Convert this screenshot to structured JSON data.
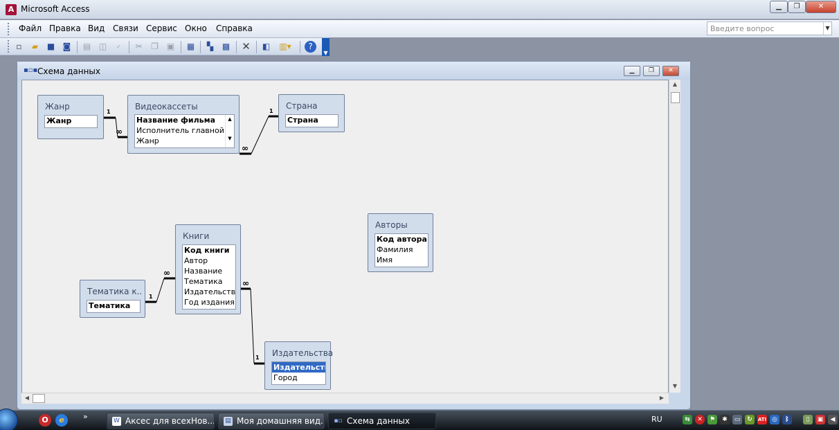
{
  "app": {
    "title": "Microsoft Access",
    "icon": "access-app-icon"
  },
  "window_buttons": {
    "minimize": "▁",
    "restore": "❐",
    "close": "✕"
  },
  "menu": [
    "Файл",
    "Правка",
    "Вид",
    "Связи",
    "Сервис",
    "Окно",
    "Справка"
  ],
  "help": {
    "placeholder": "Введите вопрос"
  },
  "toolbar": {
    "icons": [
      "new-icon",
      "open-icon",
      "save-icon",
      "file-search-icon",
      "print-icon",
      "print-preview-icon",
      "spelling-icon",
      "cut-icon",
      "copy-icon",
      "paste-icon",
      "show-table-icon",
      "show-direct-icon",
      "show-all-icon",
      "delete-icon",
      "new-object-icon",
      "office-links-icon",
      "help-icon"
    ]
  },
  "mdi": {
    "title": "Схема данных",
    "icon": "relationships-icon"
  },
  "tables": [
    {
      "title": "Жанр",
      "fields": [
        {
          "text": "Жанр",
          "pk": true
        }
      ]
    },
    {
      "title": "Видеокассеты",
      "fields": [
        {
          "text": "Название фильма",
          "pk": true
        },
        {
          "text": "Исполнитель главной ро",
          "pk": false
        },
        {
          "text": "Жанр",
          "pk": false
        }
      ]
    },
    {
      "title": "Страна",
      "fields": [
        {
          "text": "Страна",
          "pk": true
        }
      ]
    },
    {
      "title": "Книги",
      "fields": [
        {
          "text": "Код книги",
          "pk": true
        },
        {
          "text": "Автор",
          "pk": false
        },
        {
          "text": "Название",
          "pk": false
        },
        {
          "text": "Тематика",
          "pk": false
        },
        {
          "text": "Издательство",
          "pk": false
        },
        {
          "text": "Год издания",
          "pk": false
        }
      ]
    },
    {
      "title": "Авторы",
      "fields": [
        {
          "text": "Код автора",
          "pk": true
        },
        {
          "text": "Фамилия",
          "pk": false
        },
        {
          "text": "Имя",
          "pk": false
        }
      ]
    },
    {
      "title": "Тематика к...",
      "fields": [
        {
          "text": "Тематика",
          "pk": true
        }
      ]
    },
    {
      "title": "Издательства",
      "fields": [
        {
          "text": "Издательство",
          "pk": true,
          "selected": true
        },
        {
          "text": "Город",
          "pk": false
        }
      ]
    }
  ],
  "cardinality": {
    "one": "1",
    "many": "∞"
  },
  "taskbar": {
    "tasks": [
      "Аксес для всехНов...",
      "Моя домашняя вид...",
      "Схема данных"
    ],
    "language": "RU",
    "quicklaunch_more": "»"
  }
}
